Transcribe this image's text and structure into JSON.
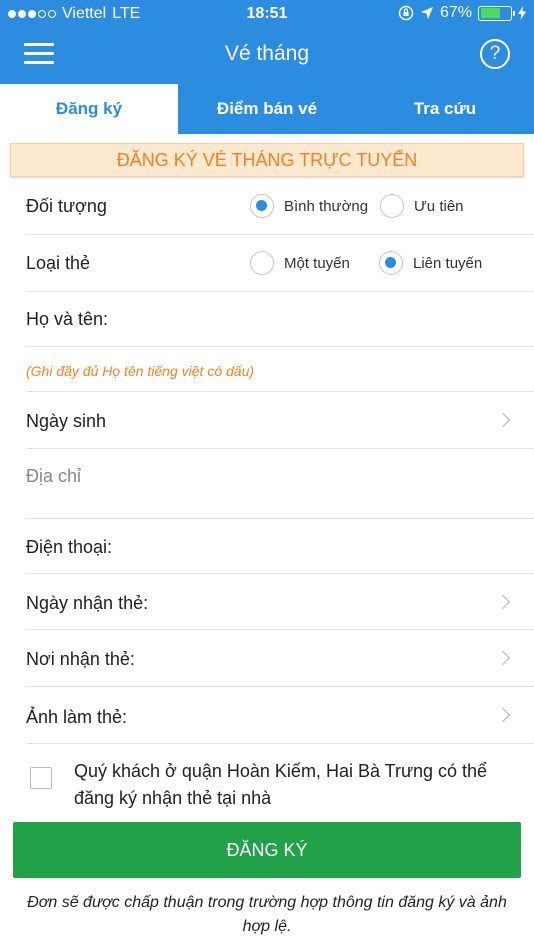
{
  "status_bar": {
    "carrier": "Viettel",
    "network": "LTE",
    "time": "18:51",
    "battery": "67%"
  },
  "nav": {
    "title": "Vé tháng",
    "help_symbol": "?"
  },
  "tabs": [
    {
      "label": "Đăng ký",
      "active": true
    },
    {
      "label": "Điểm bán vé",
      "active": false
    },
    {
      "label": "Tra cứu",
      "active": false
    }
  ],
  "banner": "ĐĂNG KÝ VÉ THÁNG TRỰC TUYẾN",
  "form": {
    "doi_tuong": {
      "label": "Đối tượng",
      "options": [
        "Bình thường",
        "Ưu tiên"
      ],
      "selected": "Bình thường"
    },
    "loai_the": {
      "label": "Loại thẻ",
      "options": [
        "Một tuyến",
        "Liên tuyến"
      ],
      "selected": "Liên tuyến"
    },
    "ho_ten": {
      "label": "Họ và tên:"
    },
    "ho_ten_note": "(Ghi đầy đủ Họ tên tiếng việt có dấu)",
    "ngay_sinh": {
      "label": "Ngày sinh"
    },
    "dia_chi": {
      "placeholder": "Địa chỉ"
    },
    "dien_thoai": {
      "label": "Điện thoại:"
    },
    "ngay_nhan_the": {
      "label": "Ngày nhận thẻ:"
    },
    "noi_nhan_the": {
      "label": "Nơi nhận thẻ:"
    },
    "anh_lam_the": {
      "label": "Ảnh làm thẻ:"
    },
    "home_delivery": {
      "checked": false,
      "text": "Quý khách ở quận Hoàn Kiếm, Hai Bà Trưng có thể đăng ký nhận thẻ tại nhà"
    }
  },
  "submit_label": "ĐĂNG KÝ",
  "footer_note": "Đơn sẽ được chấp thuận trong trường hợp thông tin đăng ký và ảnh hợp lệ.",
  "colors": {
    "primary": "#2b8ce0",
    "accent_orange": "#f58220",
    "submit_green": "#21a249"
  }
}
